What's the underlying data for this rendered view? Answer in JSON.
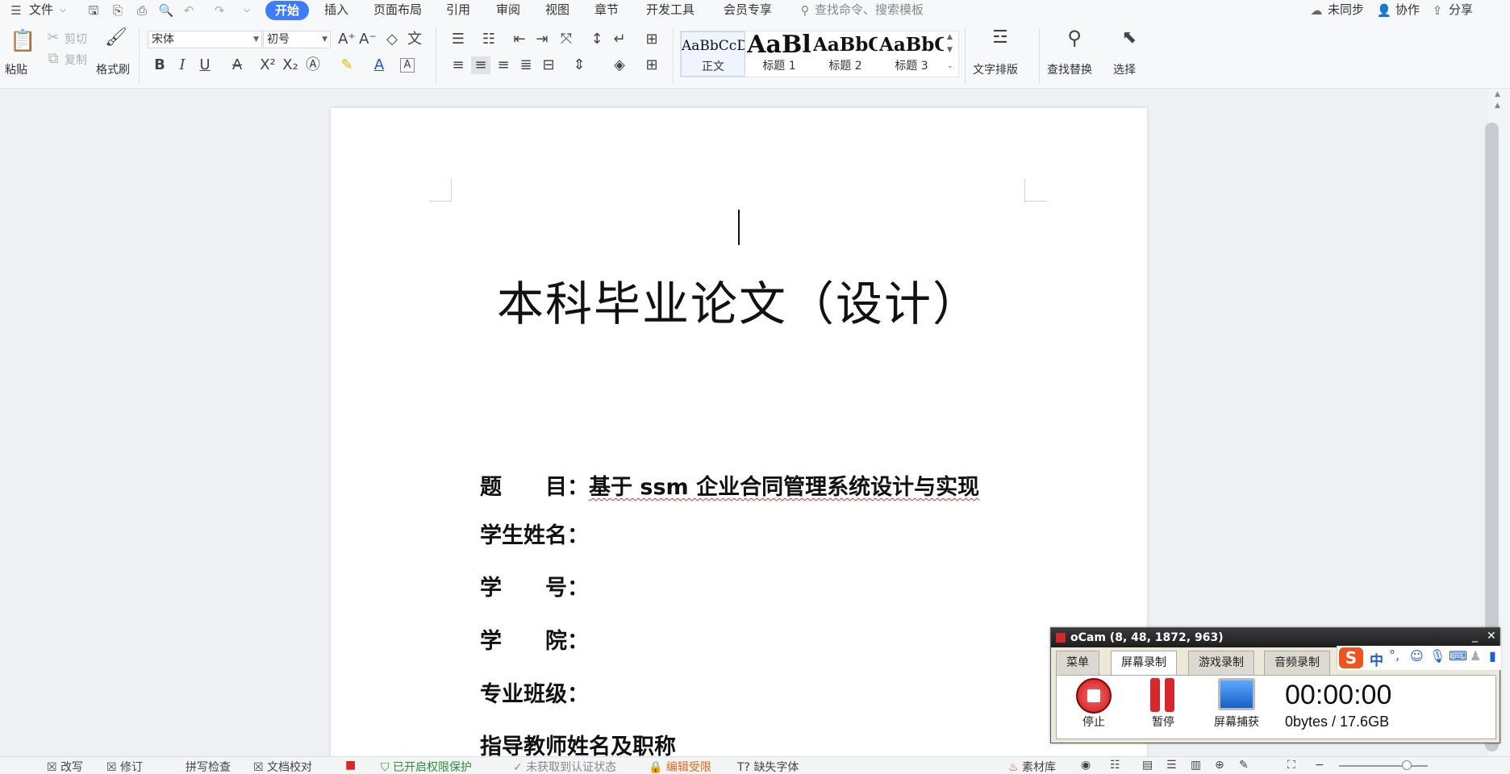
{
  "menubar": {
    "file_menu": "文件",
    "tabs": [
      "开始",
      "插入",
      "页面布局",
      "引用",
      "审阅",
      "视图",
      "章节",
      "开发工具",
      "会员专享"
    ],
    "search_placeholder": "查找命令、搜索模板",
    "sync": "未同步",
    "collab": "协作",
    "share": "分享"
  },
  "ribbon": {
    "paste": "粘贴",
    "cut": "剪切",
    "copy": "复制",
    "format_painter": "格式刷",
    "font_name": "宋体",
    "font_size": "初号",
    "styles": [
      {
        "preview": "AaBbCcDd",
        "label": "正文"
      },
      {
        "preview": "AaBl",
        "label": "标题 1"
      },
      {
        "preview": "AaBbC",
        "label": "标题 2"
      },
      {
        "preview": "AaBbC",
        "label": "标题 3"
      }
    ],
    "text_layout": "文字排版",
    "find_replace": "查找替换",
    "select": "选择"
  },
  "document": {
    "title": "本科毕业论文（设计）",
    "fields": [
      {
        "label": "题　　目：",
        "value": "基于 ssm 企业合同管理系统设计与实现"
      },
      {
        "label": "学生姓名：",
        "value": ""
      },
      {
        "label": "学　　号：",
        "value": ""
      },
      {
        "label": "学　　院：",
        "value": ""
      },
      {
        "label": "专业班级：",
        "value": ""
      },
      {
        "label": "指导教师姓名及职称",
        "value": ""
      }
    ]
  },
  "statusbar": {
    "items": [
      "改写",
      "修订",
      "拼写检查",
      "文档校对",
      "已开启权限保护",
      "未获取到认证状态",
      "编辑受限",
      "缺失字体",
      "素材库"
    ]
  },
  "ocam": {
    "title": "oCam (8, 48, 1872, 963)",
    "tabs": [
      "菜单",
      "屏幕录制",
      "游戏录制",
      "音频录制"
    ],
    "stop": "停止",
    "pause": "暂停",
    "capture": "屏幕捕获",
    "timer": "00:00:00",
    "size": "0bytes / 17.6GB"
  },
  "ime": {
    "mode": "中"
  },
  "colors": {
    "accent": "#3d7bff",
    "ocam_red": "#d7262c",
    "page_bg": "#eef0f3"
  }
}
